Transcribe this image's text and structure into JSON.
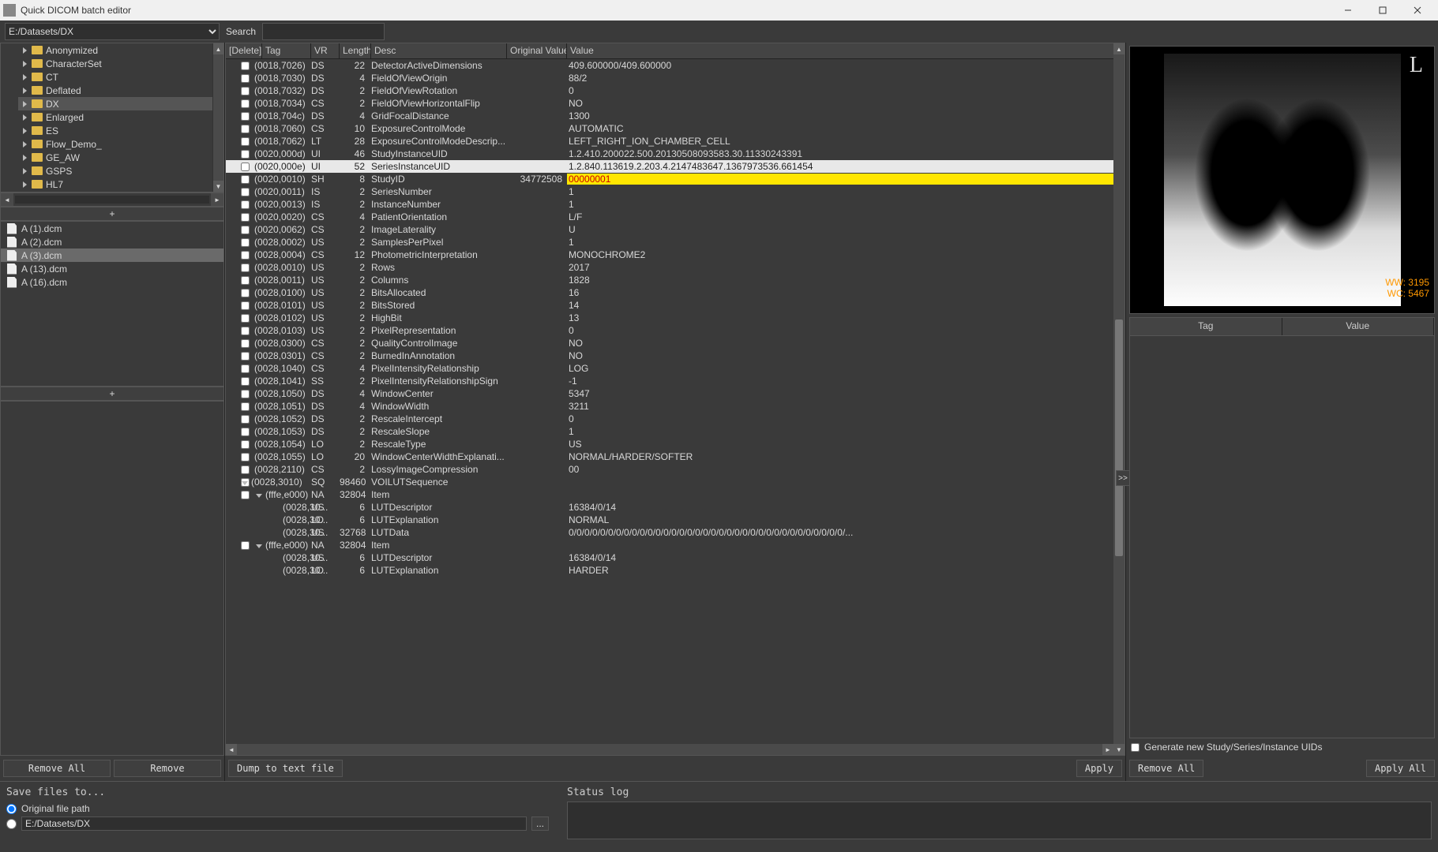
{
  "window": {
    "title": "Quick DICOM batch editor"
  },
  "path": "E:/Datasets/DX",
  "search_label": "Search",
  "search_value": "",
  "tree": {
    "items": [
      {
        "label": "Anonymized"
      },
      {
        "label": "CharacterSet"
      },
      {
        "label": "CT"
      },
      {
        "label": "Deflated"
      },
      {
        "label": "DX",
        "selected": true
      },
      {
        "label": "Enlarged"
      },
      {
        "label": "ES"
      },
      {
        "label": "Flow_Demo_"
      },
      {
        "label": "GE_AW"
      },
      {
        "label": "GSPS"
      },
      {
        "label": "HL7"
      }
    ],
    "add_label": "+"
  },
  "files": {
    "items": [
      {
        "label": "A (1).dcm"
      },
      {
        "label": "A (2).dcm"
      },
      {
        "label": "A (3).dcm",
        "selected": true
      },
      {
        "label": "A (13).dcm"
      },
      {
        "label": "A (16).dcm"
      }
    ],
    "add_label": "+"
  },
  "left_buttons": {
    "remove_all": "Remove All",
    "remove": "Remove"
  },
  "tag_table": {
    "headers": {
      "del": "[Delete]",
      "tag": "Tag",
      "vr": "VR",
      "len": "Length",
      "desc": "Desc",
      "orig": "Original Value",
      "val": "Value"
    },
    "rows": [
      {
        "tag": "(0018,7026)",
        "vr": "DS",
        "len": "22",
        "desc": "DetectorActiveDimensions",
        "ov": "",
        "val": "409.600000/409.600000"
      },
      {
        "tag": "(0018,7030)",
        "vr": "DS",
        "len": "4",
        "desc": "FieldOfViewOrigin",
        "ov": "",
        "val": "88/2"
      },
      {
        "tag": "(0018,7032)",
        "vr": "DS",
        "len": "2",
        "desc": "FieldOfViewRotation",
        "ov": "",
        "val": "0"
      },
      {
        "tag": "(0018,7034)",
        "vr": "CS",
        "len": "2",
        "desc": "FieldOfViewHorizontalFlip",
        "ov": "",
        "val": "NO"
      },
      {
        "tag": "(0018,704c)",
        "vr": "DS",
        "len": "4",
        "desc": "GridFocalDistance",
        "ov": "",
        "val": "1300"
      },
      {
        "tag": "(0018,7060)",
        "vr": "CS",
        "len": "10",
        "desc": "ExposureControlMode",
        "ov": "",
        "val": "AUTOMATIC"
      },
      {
        "tag": "(0018,7062)",
        "vr": "LT",
        "len": "28",
        "desc": "ExposureControlModeDescrip...",
        "ov": "",
        "val": "LEFT_RIGHT_ION_CHAMBER_CELL"
      },
      {
        "tag": "(0020,000d)",
        "vr": "UI",
        "len": "46",
        "desc": "StudyInstanceUID",
        "ov": "",
        "val": "1.2.410.200022.500.20130508093583.30.11330243391"
      },
      {
        "tag": "(0020,000e)",
        "vr": "UI",
        "len": "52",
        "desc": "SeriesInstanceUID",
        "ov": "",
        "val": "1.2.840.113619.2.203.4.2147483647.1367973536.661454",
        "sel": true
      },
      {
        "tag": "(0020,0010)",
        "vr": "SH",
        "len": "8",
        "desc": "StudyID",
        "ov": "34772508",
        "val": "00000001",
        "hl": true
      },
      {
        "tag": "(0020,0011)",
        "vr": "IS",
        "len": "2",
        "desc": "SeriesNumber",
        "ov": "",
        "val": "1"
      },
      {
        "tag": "(0020,0013)",
        "vr": "IS",
        "len": "2",
        "desc": "InstanceNumber",
        "ov": "",
        "val": "1"
      },
      {
        "tag": "(0020,0020)",
        "vr": "CS",
        "len": "4",
        "desc": "PatientOrientation",
        "ov": "",
        "val": "L/F"
      },
      {
        "tag": "(0020,0062)",
        "vr": "CS",
        "len": "2",
        "desc": "ImageLaterality",
        "ov": "",
        "val": "U"
      },
      {
        "tag": "(0028,0002)",
        "vr": "US",
        "len": "2",
        "desc": "SamplesPerPixel",
        "ov": "",
        "val": "1"
      },
      {
        "tag": "(0028,0004)",
        "vr": "CS",
        "len": "12",
        "desc": "PhotometricInterpretation",
        "ov": "",
        "val": "MONOCHROME2"
      },
      {
        "tag": "(0028,0010)",
        "vr": "US",
        "len": "2",
        "desc": "Rows",
        "ov": "",
        "val": "2017"
      },
      {
        "tag": "(0028,0011)",
        "vr": "US",
        "len": "2",
        "desc": "Columns",
        "ov": "",
        "val": "1828"
      },
      {
        "tag": "(0028,0100)",
        "vr": "US",
        "len": "2",
        "desc": "BitsAllocated",
        "ov": "",
        "val": "16"
      },
      {
        "tag": "(0028,0101)",
        "vr": "US",
        "len": "2",
        "desc": "BitsStored",
        "ov": "",
        "val": "14"
      },
      {
        "tag": "(0028,0102)",
        "vr": "US",
        "len": "2",
        "desc": "HighBit",
        "ov": "",
        "val": "13"
      },
      {
        "tag": "(0028,0103)",
        "vr": "US",
        "len": "2",
        "desc": "PixelRepresentation",
        "ov": "",
        "val": "0"
      },
      {
        "tag": "(0028,0300)",
        "vr": "CS",
        "len": "2",
        "desc": "QualityControlImage",
        "ov": "",
        "val": "NO"
      },
      {
        "tag": "(0028,0301)",
        "vr": "CS",
        "len": "2",
        "desc": "BurnedInAnnotation",
        "ov": "",
        "val": "NO"
      },
      {
        "tag": "(0028,1040)",
        "vr": "CS",
        "len": "4",
        "desc": "PixelIntensityRelationship",
        "ov": "",
        "val": "LOG"
      },
      {
        "tag": "(0028,1041)",
        "vr": "SS",
        "len": "2",
        "desc": "PixelIntensityRelationshipSign",
        "ov": "",
        "val": "-1"
      },
      {
        "tag": "(0028,1050)",
        "vr": "DS",
        "len": "4",
        "desc": "WindowCenter",
        "ov": "",
        "val": "5347"
      },
      {
        "tag": "(0028,1051)",
        "vr": "DS",
        "len": "4",
        "desc": "WindowWidth",
        "ov": "",
        "val": "3211"
      },
      {
        "tag": "(0028,1052)",
        "vr": "DS",
        "len": "2",
        "desc": "RescaleIntercept",
        "ov": "",
        "val": "0"
      },
      {
        "tag": "(0028,1053)",
        "vr": "DS",
        "len": "2",
        "desc": "RescaleSlope",
        "ov": "",
        "val": "1"
      },
      {
        "tag": "(0028,1054)",
        "vr": "LO",
        "len": "2",
        "desc": "RescaleType",
        "ov": "",
        "val": "US"
      },
      {
        "tag": "(0028,1055)",
        "vr": "LO",
        "len": "20",
        "desc": "WindowCenterWidthExplanati...",
        "ov": "",
        "val": "NORMAL/HARDER/SOFTER"
      },
      {
        "tag": "(0028,2110)",
        "vr": "CS",
        "len": "2",
        "desc": "LossyImageCompression",
        "ov": "",
        "val": "00"
      },
      {
        "tag": "(0028,3010)",
        "vr": "SQ",
        "len": "98460",
        "desc": "VOILUTSequence",
        "ov": "",
        "val": "",
        "exp": true,
        "lvl": 0
      },
      {
        "tag": "(fffe,e000)",
        "vr": "NA",
        "len": "32804",
        "desc": "Item",
        "ov": "",
        "val": "",
        "exp": true,
        "lvl": 1
      },
      {
        "tag": "(0028,30...",
        "vr": "US",
        "len": "6",
        "desc": "LUTDescriptor",
        "ov": "",
        "val": "16384/0/14",
        "lvl": 2
      },
      {
        "tag": "(0028,30...",
        "vr": "LO",
        "len": "6",
        "desc": "LUTExplanation",
        "ov": "",
        "val": "NORMAL",
        "lvl": 2
      },
      {
        "tag": "(0028,30...",
        "vr": "US",
        "len": "32768",
        "desc": "LUTData",
        "ov": "",
        "val": "0/0/0/0/0/0/0/0/0/0/0/0/0/0/0/0/0/0/0/0/0/0/0/0/0/0/0/0/0/0/0/0/0/0/0/...",
        "lvl": 2
      },
      {
        "tag": "(fffe,e000)",
        "vr": "NA",
        "len": "32804",
        "desc": "Item",
        "ov": "",
        "val": "",
        "exp": true,
        "lvl": 1
      },
      {
        "tag": "(0028,30...",
        "vr": "US",
        "len": "6",
        "desc": "LUTDescriptor",
        "ov": "",
        "val": "16384/0/14",
        "lvl": 2
      },
      {
        "tag": "(0028,30...",
        "vr": "LO",
        "len": "6",
        "desc": "LUTExplanation",
        "ov": "",
        "val": "HARDER",
        "lvl": 2
      }
    ]
  },
  "center_buttons": {
    "dump": "Dump to text file",
    "apply": "Apply"
  },
  "preview": {
    "marker": "L",
    "ww": "WW: 3195",
    "wc": "WC: 5467"
  },
  "sub_table": {
    "th_tag": "Tag",
    "th_val": "Value"
  },
  "expander": ">>",
  "gen_uid_label": "Generate new Study/Series/Instance UIDs",
  "right_buttons": {
    "remove_all": "Remove All",
    "apply_all": "Apply All"
  },
  "save": {
    "heading": "Save files to...",
    "opt_original": "Original file path",
    "opt_custom_path": "E:/Datasets/DX",
    "browse": "..."
  },
  "status": {
    "heading": "Status log"
  }
}
